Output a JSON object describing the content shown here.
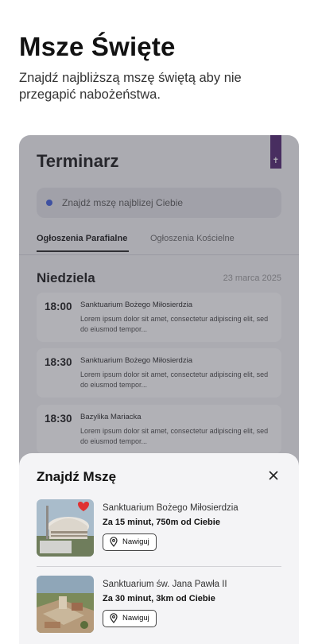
{
  "hero": {
    "title": "Msze Święte",
    "subtitle": "Znajdź najbliższą mszę świętą aby nie przegapić nabożeństwa."
  },
  "app": {
    "title": "Terminarz",
    "bookmark_glyph": "✝",
    "search_placeholder": "Znajdź mszę najblizej Ciebie",
    "tabs": [
      {
        "label": "Ogłoszenia Parafialne",
        "active": true
      },
      {
        "label": "Ogłoszenia Kościelne",
        "active": false
      }
    ],
    "day": {
      "name": "Niedziela",
      "date": "23 marca 2025"
    },
    "events": [
      {
        "time": "18:00",
        "place": "Sanktuarium Bożego Miłosierdzia",
        "desc": "Lorem ipsum dolor sit amet, consectetur adipiscing elit, sed do eiusmod tempor..."
      },
      {
        "time": "18:30",
        "place": "Sanktuarium Bożego Miłosierdzia",
        "desc": "Lorem ipsum dolor sit amet, consectetur adipiscing elit, sed do eiusmod tempor..."
      },
      {
        "time": "18:30",
        "place": "Bazylika Mariacka",
        "desc": "Lorem ipsum dolor sit amet, consectetur adipiscing elit, sed do eiusmod tempor..."
      }
    ]
  },
  "sheet": {
    "title": "Znajdź Mszę",
    "places": [
      {
        "name": "Sanktuarium Bożego Miłosierdzia",
        "distance": "Za 15 minut, 750m od Ciebie",
        "button": "Nawiguj",
        "favorite": true
      },
      {
        "name": "Sanktuarium św. Jana Pawła II",
        "distance": "Za 30 minut, 3km od Ciebie",
        "button": "Nawiguj",
        "favorite": false
      }
    ]
  },
  "colors": {
    "accent_purple": "#4b1e6b",
    "search_dot": "#3b5bdb",
    "favorite_red": "#e03131"
  }
}
